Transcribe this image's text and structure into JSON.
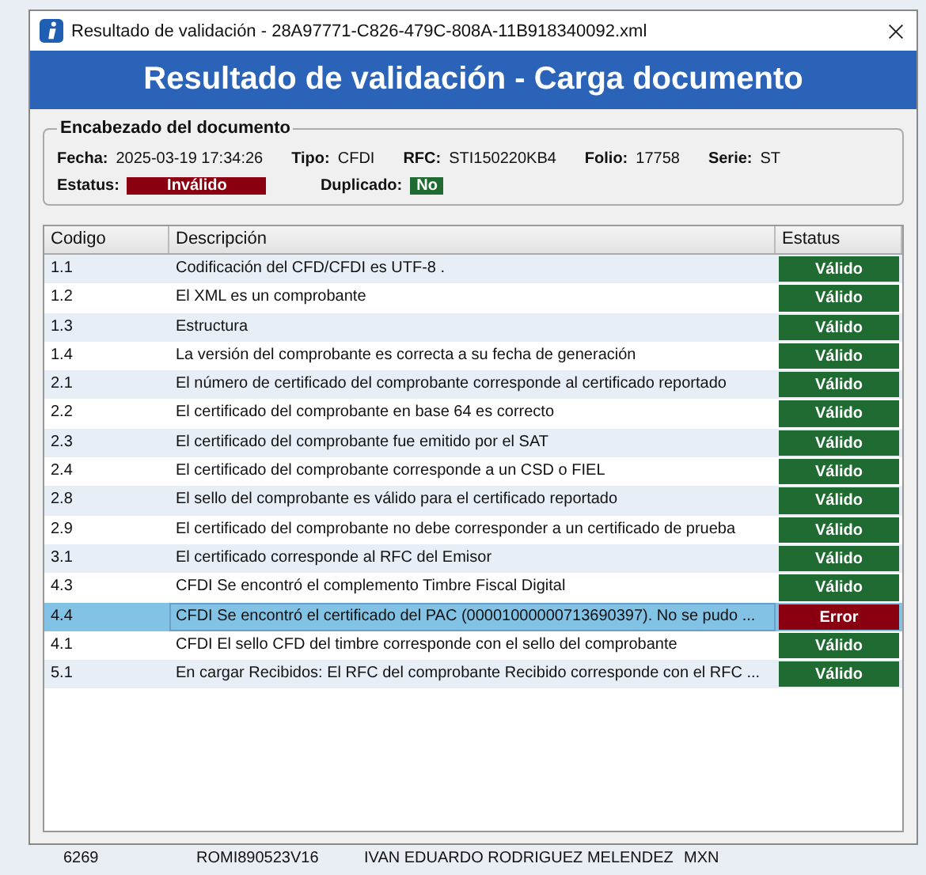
{
  "window": {
    "title": "Resultado de validación - 28A97771-C826-479C-808A-11B918340092.xml"
  },
  "banner": "Resultado de validación - Carga documento",
  "header_group": {
    "title": "Encabezado del documento",
    "fields": [
      {
        "label": "Fecha:",
        "value": "2025-03-19 17:34:26"
      },
      {
        "label": "Tipo:",
        "value": "CFDI"
      },
      {
        "label": "RFC:",
        "value": "STI150220KB4"
      },
      {
        "label": "Folio:",
        "value": "17758"
      },
      {
        "label": "Serie:",
        "value": "ST"
      }
    ],
    "status": {
      "label": "Estatus:",
      "value": "Inválido",
      "kind": "error"
    },
    "duplicate": {
      "label": "Duplicado:",
      "value": "No",
      "kind": "valid"
    }
  },
  "table": {
    "columns": [
      "Codigo",
      "Descripción",
      "Estatus"
    ],
    "rows": [
      {
        "code": "1.1",
        "description": "Codificación del CFD/CFDI es UTF-8 .",
        "status": "Válido",
        "kind": "valid",
        "selected": false
      },
      {
        "code": "1.2",
        "description": "El XML es un comprobante",
        "status": "Válido",
        "kind": "valid",
        "selected": false
      },
      {
        "code": "1.3",
        "description": "Estructura",
        "status": "Válido",
        "kind": "valid",
        "selected": false
      },
      {
        "code": "1.4",
        "description": "La versión del comprobante es correcta a su fecha de generación",
        "status": "Válido",
        "kind": "valid",
        "selected": false
      },
      {
        "code": "2.1",
        "description": "El número de certificado del comprobante corresponde al certificado reportado",
        "status": "Válido",
        "kind": "valid",
        "selected": false
      },
      {
        "code": "2.2",
        "description": "El certificado del comprobante en base 64 es correcto",
        "status": "Válido",
        "kind": "valid",
        "selected": false
      },
      {
        "code": "2.3",
        "description": "El certificado del comprobante fue emitido por el SAT",
        "status": "Válido",
        "kind": "valid",
        "selected": false
      },
      {
        "code": "2.4",
        "description": "El certificado del comprobante corresponde a un CSD o FIEL",
        "status": "Válido",
        "kind": "valid",
        "selected": false
      },
      {
        "code": "2.8",
        "description": "El sello del comprobante es válido para el certificado reportado",
        "status": "Válido",
        "kind": "valid",
        "selected": false
      },
      {
        "code": "2.9",
        "description": "El certificado del comprobante no debe corresponder a un certificado de prueba",
        "status": "Válido",
        "kind": "valid",
        "selected": false
      },
      {
        "code": "3.1",
        "description": "El certificado corresponde al RFC del Emisor",
        "status": "Válido",
        "kind": "valid",
        "selected": false
      },
      {
        "code": "4.3",
        "description": "CFDI Se encontró el complemento Timbre Fiscal Digital",
        "status": "Válido",
        "kind": "valid",
        "selected": false
      },
      {
        "code": "4.4",
        "description": "CFDI Se encontró el certificado  del PAC   (00001000000713690397). No se pudo ...",
        "status": "Error",
        "kind": "error",
        "selected": true
      },
      {
        "code": "4.1",
        "description": "CFDI El sello CFD del timbre corresponde con el sello del comprobante",
        "status": "Válido",
        "kind": "valid",
        "selected": false
      },
      {
        "code": "5.1",
        "description": "En cargar Recibidos: El RFC del comprobante Recibido corresponde con el RFC ...",
        "status": "Válido",
        "kind": "valid",
        "selected": false
      }
    ]
  },
  "background_row": [
    "6269",
    "ROMI890523V16",
    "IVAN EDUARDO RODRIGUEZ MELENDEZ",
    "MXN"
  ]
}
